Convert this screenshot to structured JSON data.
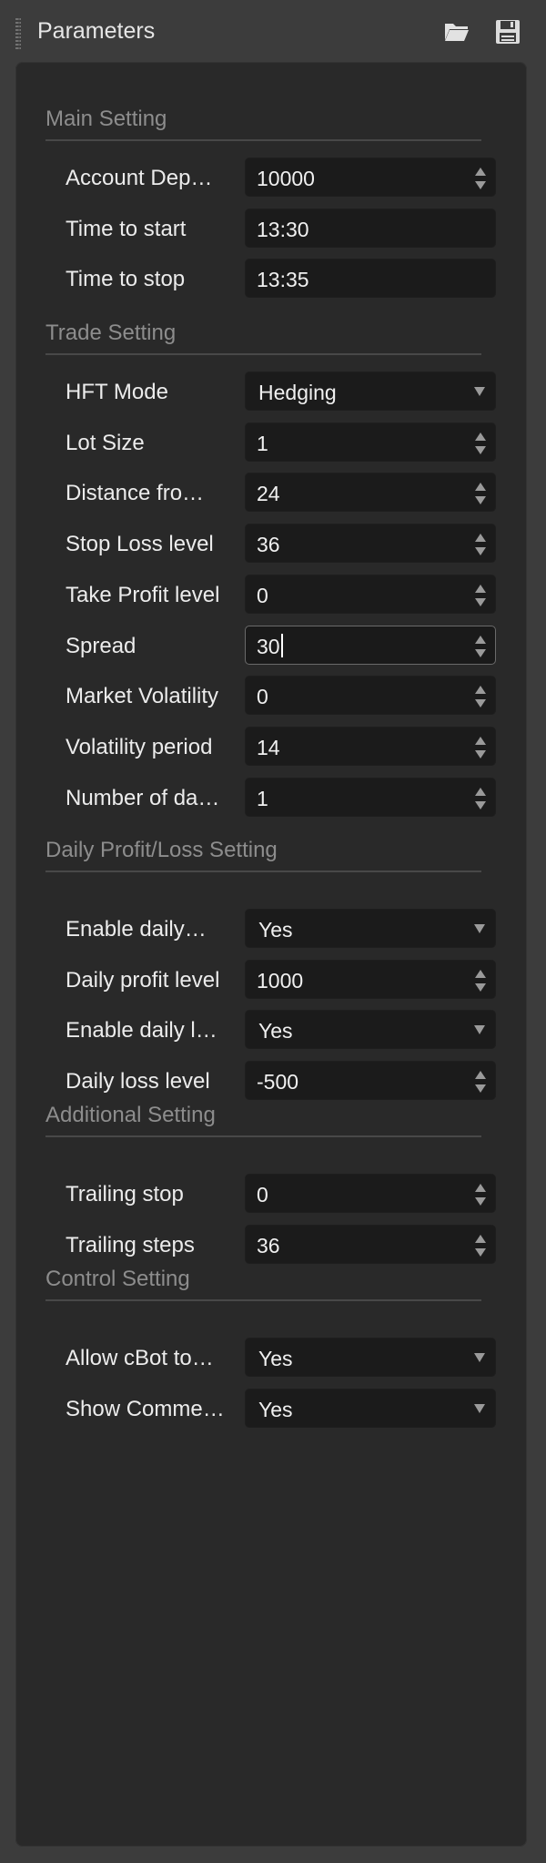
{
  "window": {
    "title": "Parameters"
  },
  "toolbar": {
    "open_icon": "folder-open-icon",
    "save_icon": "floppy-disk-icon"
  },
  "sections": [
    {
      "header": "Main Setting",
      "rows": [
        {
          "label": "Account Dep…",
          "value": "10000",
          "type": "number"
        },
        {
          "label": "Time to start",
          "value": "13:30",
          "type": "text"
        },
        {
          "label": "Time to stop",
          "value": "13:35",
          "type": "text"
        }
      ]
    },
    {
      "header": "Trade Setting",
      "rows": [
        {
          "label": "HFT Mode",
          "value": "Hedging",
          "type": "select"
        },
        {
          "label": "Lot Size",
          "value": "1",
          "type": "number"
        },
        {
          "label": "Distance fro…",
          "value": "24",
          "type": "number"
        },
        {
          "label": "Stop Loss level",
          "value": "36",
          "type": "number"
        },
        {
          "label": "Take Profit level",
          "value": "0",
          "type": "number"
        },
        {
          "label": "Spread",
          "value": "30",
          "type": "number",
          "focused": true
        },
        {
          "label": "Market Volatility",
          "value": "0",
          "type": "number"
        },
        {
          "label": "Volatility period",
          "value": "14",
          "type": "number"
        },
        {
          "label": "Number of da…",
          "value": "1",
          "type": "number"
        }
      ]
    },
    {
      "header": "Daily Profit/Loss Setting",
      "rows": [
        {
          "label": "Enable daily…",
          "value": "Yes",
          "type": "select"
        },
        {
          "label": "Daily profit level",
          "value": "1000",
          "type": "number"
        },
        {
          "label": "Enable daily l…",
          "value": "Yes",
          "type": "select"
        },
        {
          "label": "Daily loss level",
          "value": "-500",
          "type": "number"
        }
      ]
    },
    {
      "header": "Additional Setting",
      "rows": [
        {
          "label": "Trailing stop",
          "value": "0",
          "type": "number"
        },
        {
          "label": "Trailing steps",
          "value": "36",
          "type": "number"
        }
      ]
    },
    {
      "header": "Control Setting",
      "rows": [
        {
          "label": "Allow cBot to…",
          "value": "Yes",
          "type": "select"
        },
        {
          "label": "Show Comme…",
          "value": "Yes",
          "type": "select"
        }
      ]
    }
  ]
}
